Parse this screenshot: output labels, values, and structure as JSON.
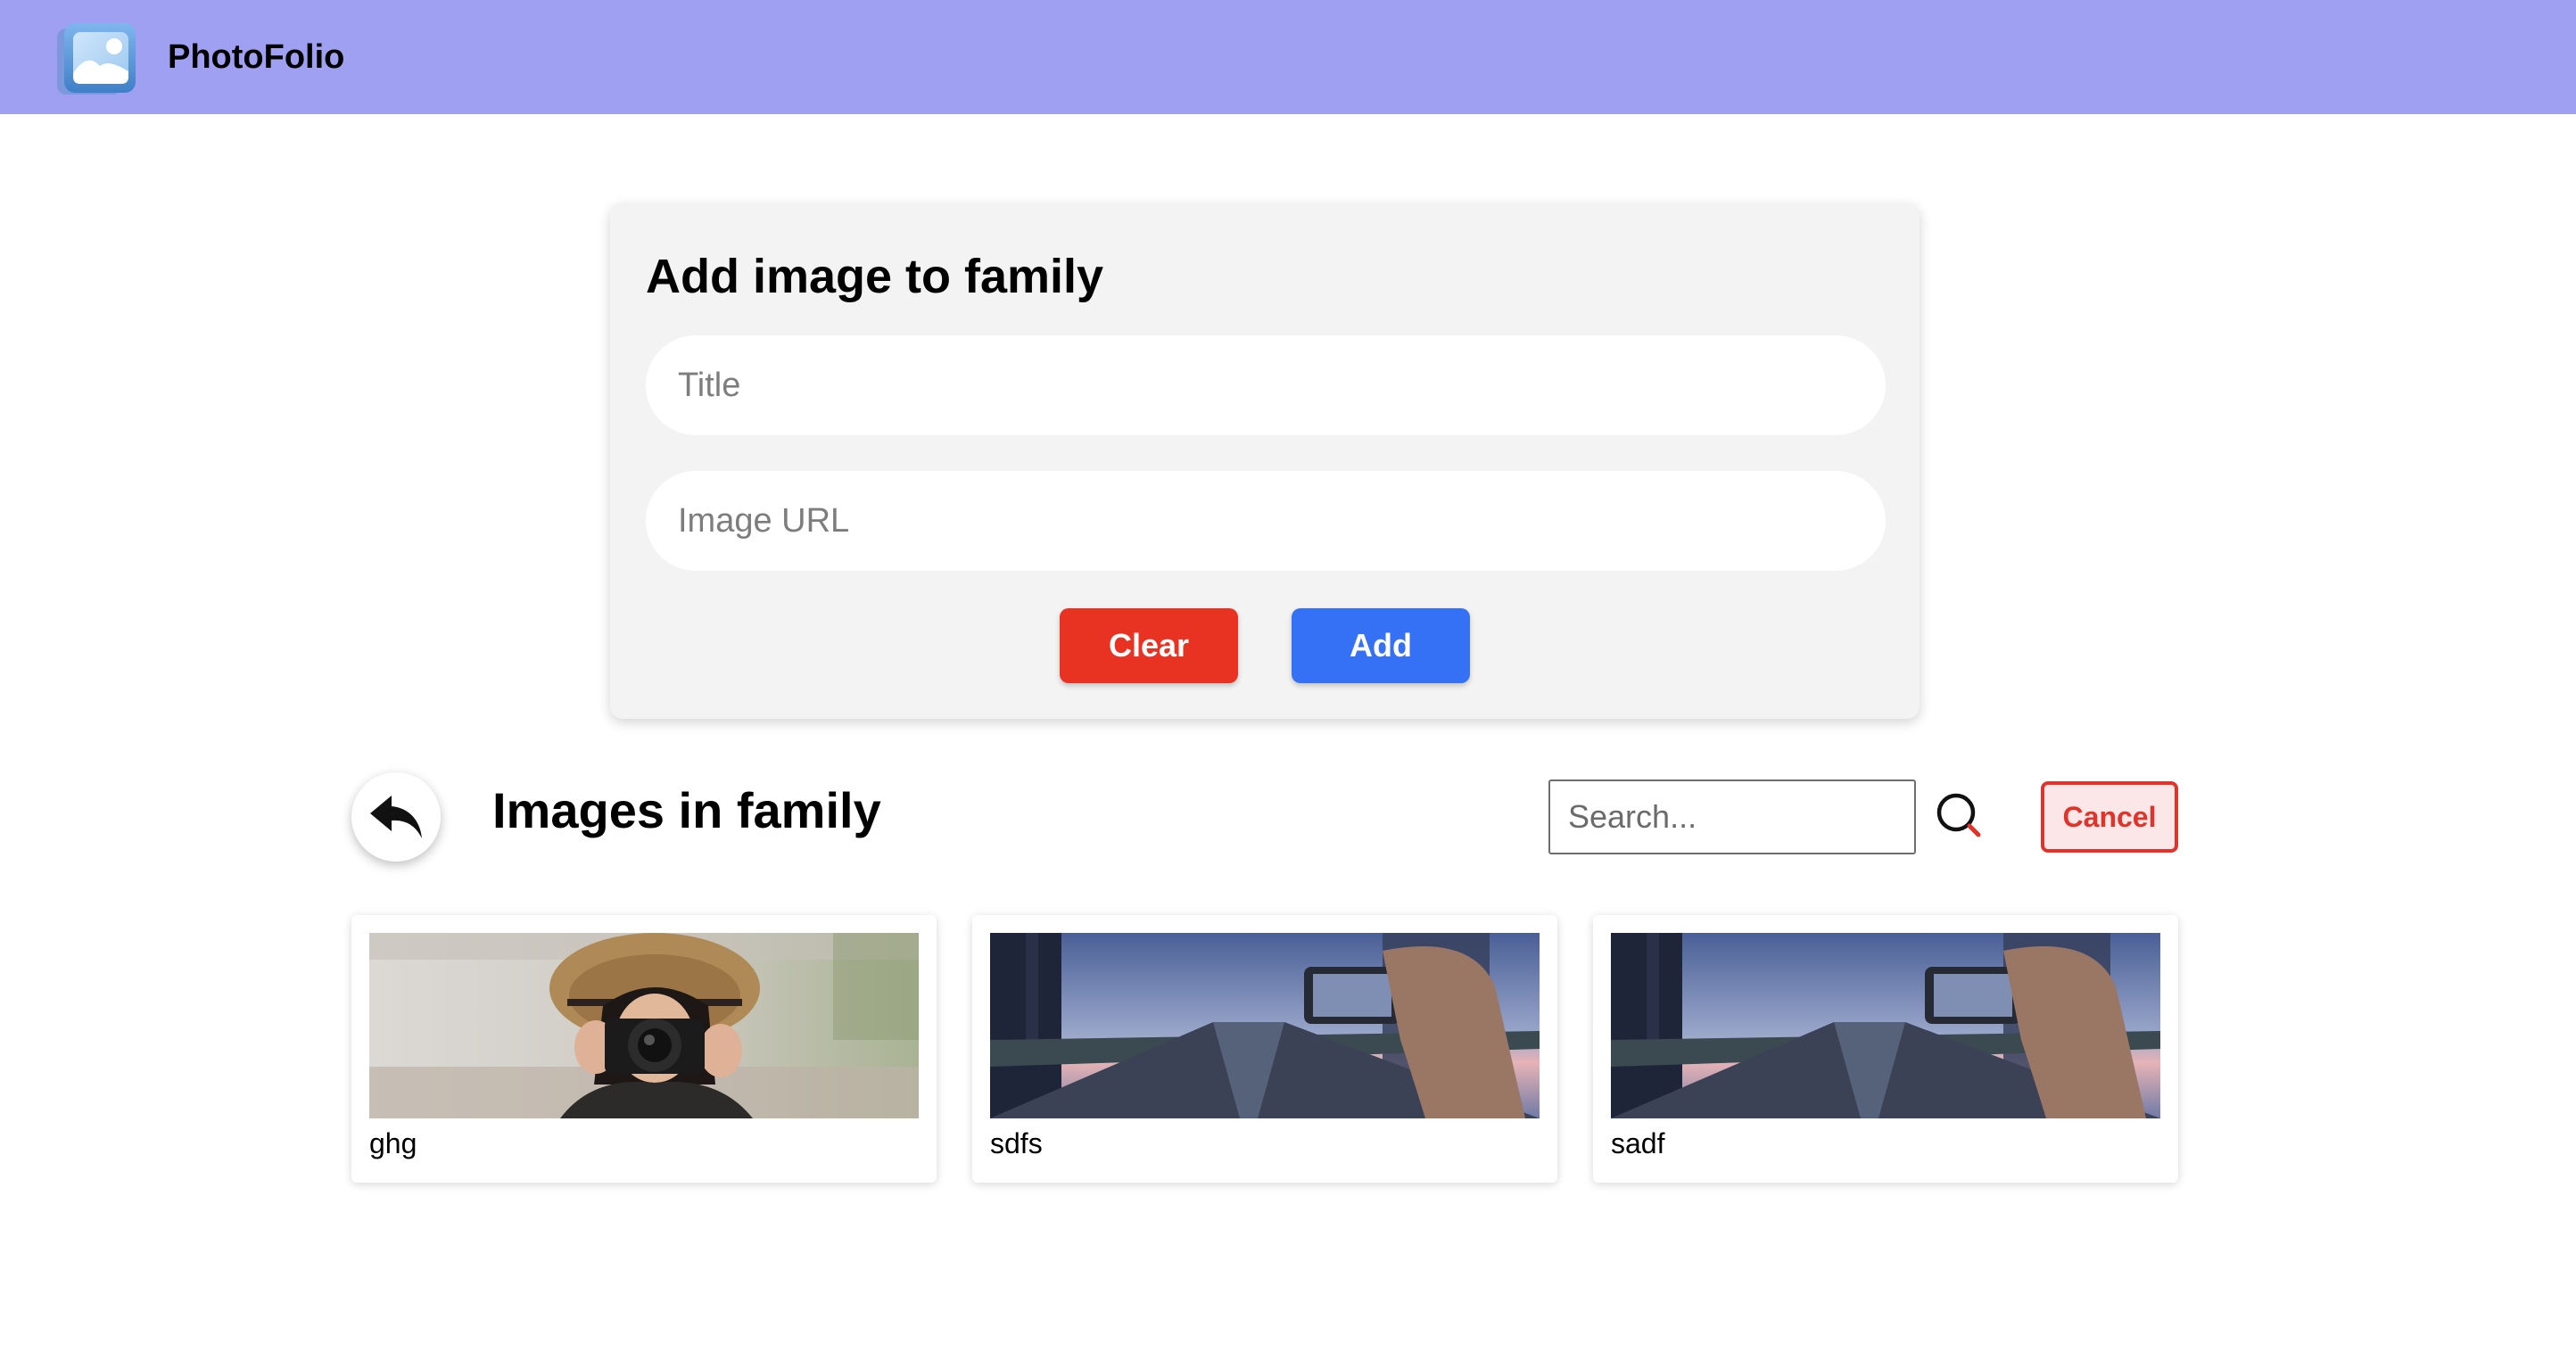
{
  "app": {
    "brand": "PhotoFolio"
  },
  "form": {
    "title": "Add image to family",
    "title_placeholder": "Title",
    "url_placeholder": "Image URL",
    "clear_label": "Clear",
    "add_label": "Add"
  },
  "images_section": {
    "heading": "Images in family",
    "search_placeholder": "Search...",
    "cancel_label": "Cancel"
  },
  "images": [
    {
      "title": "ghg"
    },
    {
      "title": "sdfs"
    },
    {
      "title": "sadf"
    }
  ],
  "colors": {
    "navbar": "#a0a0f2",
    "clear_button": "#e93322",
    "add_button": "#3571f4",
    "cancel_button": "#e2332a"
  },
  "icons": {
    "logo": "photo-gallery-icon",
    "back": "reply-arrow-icon",
    "search": "magnifier-icon"
  }
}
